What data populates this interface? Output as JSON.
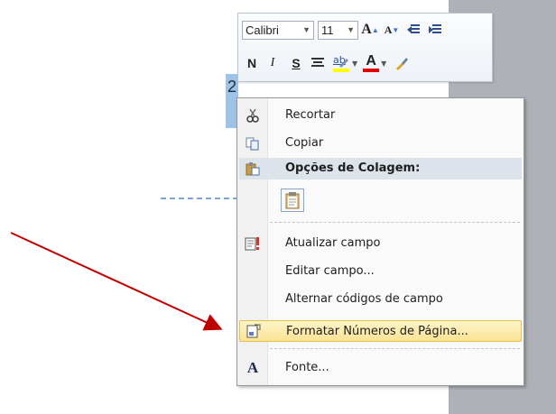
{
  "document": {
    "page_number": "2"
  },
  "mini_toolbar": {
    "font_name": "Calibri",
    "font_size": "11",
    "grow_font_label": "A",
    "shrink_font_label": "A",
    "bold_label": "N",
    "italic_label": "I",
    "shadow_label": "S",
    "highlight_letters": "ab",
    "font_color_label": "A",
    "highlight_color": "#ffff00",
    "font_color": "#e00000"
  },
  "context_menu": {
    "items": [
      {
        "label": "Recortar",
        "icon": "scissors-icon"
      },
      {
        "label": "Copiar",
        "icon": "copy-icon"
      },
      {
        "label": "Opções de Colagem:",
        "icon": "paste-options-icon"
      },
      {
        "label": "Atualizar campo",
        "icon": "update-field-icon"
      },
      {
        "label": "Editar campo...",
        "icon": ""
      },
      {
        "label": "Alternar códigos de campo",
        "icon": ""
      },
      {
        "label": "Formatar Números de Página...",
        "icon": "page-number-format-icon"
      },
      {
        "label": "Fonte...",
        "icon": "font-icon"
      }
    ],
    "highlight_color": "#fbe395"
  },
  "annotation": {
    "arrow_color": "#c00000"
  }
}
